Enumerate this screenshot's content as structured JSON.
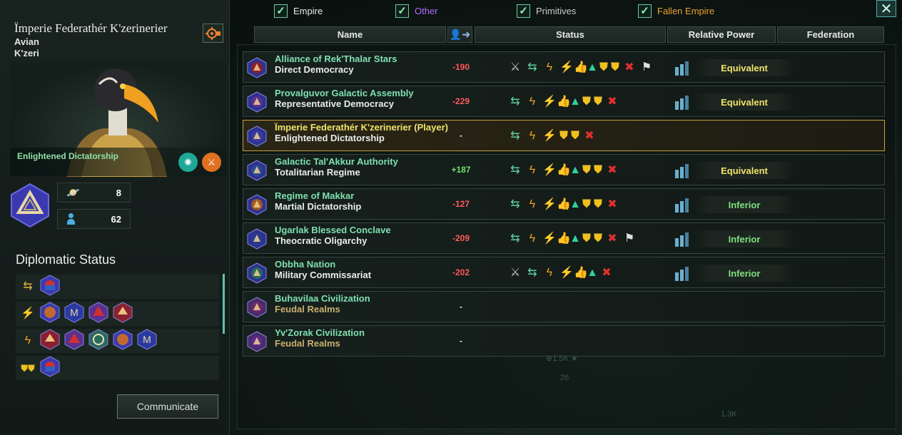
{
  "empire": {
    "name": "Ïmperie Federathér K'zerinerier",
    "species": "Avian",
    "subspecies": "K'zeri",
    "government": "Enlightened Dictatorship",
    "planets": "8",
    "pops": "62"
  },
  "diplomatic_status": {
    "title": "Diplomatic Status",
    "rows": [
      {
        "icon": "trade-arrows-icon",
        "emblems": [
          "red-blue"
        ]
      },
      {
        "icon": "research-bolt-icon",
        "emblems": [
          "orange",
          "blue",
          "purple-red",
          "red"
        ]
      },
      {
        "icon": "lightning-icon",
        "emblems": [
          "red",
          "purple-red",
          "teal",
          "orange",
          "blue"
        ]
      },
      {
        "icon": "shields-icon",
        "emblems": [
          "red-blue"
        ]
      }
    ]
  },
  "communicate_label": "Communicate",
  "filters": [
    {
      "label": "Empire",
      "color": "#e7ece7"
    },
    {
      "label": "Other",
      "color": "#b06cff"
    },
    {
      "label": "Primitives",
      "color": "#c9cfc9"
    },
    {
      "label": "Fallen Empire",
      "color": "#f0a030"
    }
  ],
  "headers": {
    "name": "Name",
    "status": "Status",
    "relative_power": "Relative Power",
    "federation": "Federation"
  },
  "empires": [
    {
      "name": "Alliance of Rek'Thalar Stars",
      "gov": "Direct Democracy",
      "opinion": "-190",
      "opinion_color": "#ff5a5a",
      "status": [
        "swords",
        "trade",
        "research",
        "bolt",
        "thumb",
        "handshake",
        "shield",
        "shield",
        "no-pact",
        "flag"
      ],
      "power": "Equivalent",
      "power_color": "#f2e36a",
      "emblem": "#8a2030"
    },
    {
      "name": "Provalguvor Galactic Assembly",
      "gov": "Representative Democracy",
      "opinion": "-229",
      "opinion_color": "#ff5a5a",
      "status": [
        "trade",
        "research",
        "bolt",
        "thumb",
        "handshake",
        "shield",
        "shield",
        "no-pact"
      ],
      "power": "Equivalent",
      "power_color": "#f2e36a",
      "emblem": "#5a3090"
    },
    {
      "name": "Ïmperie Federathér K'zerinerier (Player)",
      "gov": "Enlightened Dictatorship",
      "opinion": "-",
      "opinion_color": "#e8ede8",
      "status": [
        "trade",
        "research",
        "bolt",
        "shield",
        "shield",
        "no-pact"
      ],
      "power": "",
      "power_color": "#f2e36a",
      "emblem": "#3a3aa0",
      "player": true
    },
    {
      "name": "Galactic Tal'Akkur Authority",
      "gov": "Totalitarian Regime",
      "opinion": "+187",
      "opinion_color": "#6ee06e",
      "status": [
        "trade",
        "research",
        "bolt",
        "thumb",
        "handshake",
        "shield",
        "shield",
        "no-pact"
      ],
      "power": "Equivalent",
      "power_color": "#f2e36a",
      "emblem": "#2a4a90"
    },
    {
      "name": "Regime of Makkar",
      "gov": "Martial Dictatorship",
      "opinion": "-127",
      "opinion_color": "#ff5a5a",
      "status": [
        "trade",
        "research",
        "bolt",
        "thumb",
        "handshake",
        "shield",
        "shield",
        "no-pact"
      ],
      "power": "Inferior",
      "power_color": "#7fe07f",
      "emblem": "#a05a20"
    },
    {
      "name": "Ugarlak Blessed Conclave",
      "gov": "Theocratic Oligarchy",
      "opinion": "-209",
      "opinion_color": "#ff5a5a",
      "status": [
        "trade",
        "research",
        "bolt",
        "thumb",
        "handshake",
        "shield",
        "shield",
        "no-pact",
        "flag"
      ],
      "power": "Inferior",
      "power_color": "#7fe07f",
      "emblem": "#2a3a90"
    },
    {
      "name": "Obbha Nation",
      "gov": "Military Commissariat",
      "opinion": "-202",
      "opinion_color": "#ff5a5a",
      "status": [
        "swords",
        "trade",
        "research",
        "bolt",
        "thumb",
        "handshake",
        "no-pact"
      ],
      "power": "Inferior",
      "power_color": "#7fe07f",
      "emblem": "#2a6a5a"
    },
    {
      "name": "Buhavilaa Civilization",
      "gov": "Feudal Realms",
      "opinion": "-",
      "opinion_color": "#e8ede8",
      "status": [],
      "power": "",
      "power_color": "#7fe07f",
      "emblem": "#6a2a6a",
      "primitive": true
    },
    {
      "name": "Yv'Zorak Civilization",
      "gov": "Feudal Realms",
      "opinion": "-",
      "opinion_color": "#e8ede8",
      "status": [],
      "power": "",
      "power_color": "#7fe07f",
      "emblem": "#5a2a8a",
      "primitive": true
    }
  ],
  "colors": {
    "name_green": "#7fe0b0",
    "player_yellow": "#f2e36a",
    "primitive_gov": "#c8b070"
  }
}
